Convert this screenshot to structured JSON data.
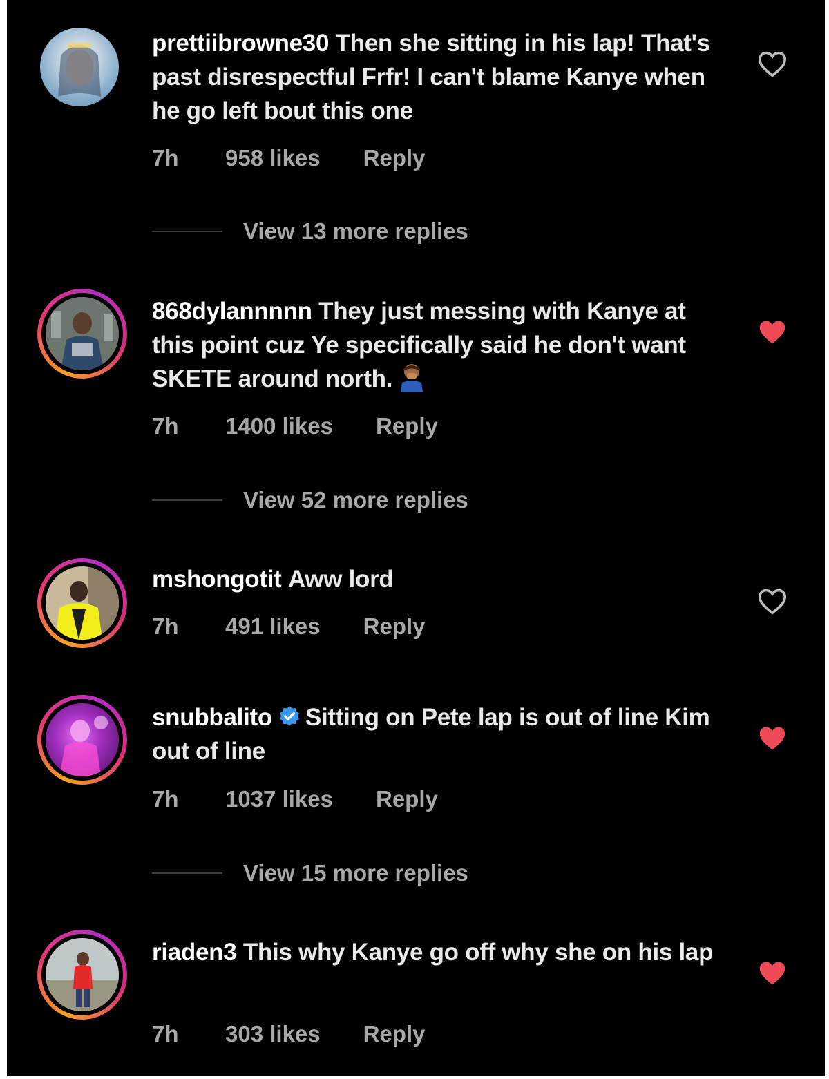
{
  "comments": [
    {
      "username": "prettiibrowne30",
      "text": "Then she sitting in his lap! That's past disrespectful Frfr! I can't blame Kanye when he go left bout this one",
      "time": "7h",
      "likes": "958 likes",
      "reply": "Reply",
      "liked": false,
      "verified": false,
      "story_ring": false,
      "view_replies": "View 13 more replies"
    },
    {
      "username": "868dylannnnn",
      "text": "They just messing with Kanye at this point cuz Ye specifically said he don't want SKETE around north.",
      "emoji": "person-facepalming-emoji",
      "time": "7h",
      "likes": "1400 likes",
      "reply": "Reply",
      "liked": true,
      "verified": false,
      "story_ring": true,
      "view_replies": "View 52 more replies"
    },
    {
      "username": "mshongotit",
      "text": "Aww lord",
      "time": "7h",
      "likes": "491 likes",
      "reply": "Reply",
      "liked": false,
      "verified": false,
      "story_ring": true
    },
    {
      "username": "snubbalito",
      "text": "Sitting on Pete lap is out of line Kim out of line",
      "time": "7h",
      "likes": "1037 likes",
      "reply": "Reply",
      "liked": true,
      "verified": true,
      "story_ring": true,
      "view_replies": "View 15 more replies"
    },
    {
      "username": "riaden3",
      "text": "This why Kanye go off why she on his lap",
      "time": "7h",
      "likes": "303 likes",
      "reply": "Reply",
      "liked": true,
      "verified": false,
      "story_ring": true
    }
  ],
  "colors": {
    "background": "#000000",
    "liked_heart": "#ed4956",
    "muted_text": "#a8a8a8",
    "verified_badge": "#3897f0"
  },
  "icons": {
    "heart_outline": "heart-outline-icon",
    "heart_filled": "heart-filled-icon",
    "verified": "verified-badge-icon"
  }
}
